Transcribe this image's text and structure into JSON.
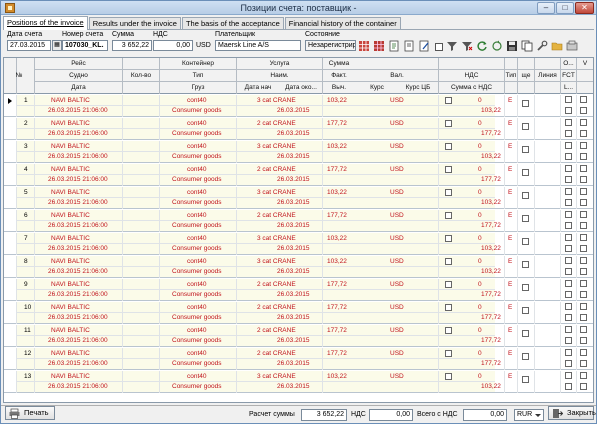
{
  "window": {
    "title": "Позиции счета: поставщик -",
    "min_label": "–",
    "max_label": "□",
    "close_label": "✕"
  },
  "tabs": [
    "Positions of the invoice",
    "Results under the invoice",
    "The basis of the acceptance",
    "Financial history of the container"
  ],
  "header": {
    "date_label": "Дата счета",
    "date_value": "27.03.2015",
    "number_label": "Номер счета",
    "number_value": "107030_KL.",
    "sum_label": "Сумма",
    "sum_value": "3 652,22",
    "vat_label": "НДС",
    "vat_value": "0,00",
    "currency": "USD",
    "payer_label": "Плательщик",
    "payer_value": "Maersk Line A/S",
    "state_label": "Состояние",
    "state_value": "Незарегистрир"
  },
  "columns": {
    "num": "№",
    "flight": "Рейс",
    "vessel": "Судно",
    "date": "Дата",
    "qty": "Кол-во",
    "container": "Контейнер",
    "type": "Тип",
    "cargo": "Груз",
    "service": "Услуга",
    "name": "Наим.",
    "start_date": "Дата нач",
    "end_date": "Дата око...",
    "sum": "Сумма",
    "fact": "Факт.",
    "calc": "Выч.",
    "currency": "Вал.",
    "rate": "Курс",
    "rate_cb": "Курс ЦБ",
    "vat": "НДС",
    "sum_vat": "Сумма с НДС",
    "tip": "Тип",
    "sche": "ще",
    "line": "Линия",
    "o": "О...",
    "fct": "FCT",
    "l": "L...",
    "v": "V"
  },
  "rows": [
    {
      "num": "1",
      "vessel": "NAVI BALTIC",
      "date": "26.03.2015 21:06:00",
      "type": "cont40",
      "cargo": "Consumer goods",
      "service": "3 cat CRANE",
      "svc_date": "26.03.2015",
      "fact": "103,22",
      "calc": "",
      "currency": "USD",
      "vat": "0",
      "sum_vat": "103,22",
      "tip": "E"
    },
    {
      "num": "2",
      "vessel": "NAVI BALTIC",
      "date": "26.03.2015 21:06:00",
      "type": "cont40",
      "cargo": "Consumer goods",
      "service": "2 cat CRANE",
      "svc_date": "26.03.2015",
      "fact": "177,72",
      "calc": "",
      "currency": "USD",
      "vat": "0",
      "sum_vat": "177,72",
      "tip": "E"
    },
    {
      "num": "3",
      "vessel": "NAVI BALTIC",
      "date": "26.03.2015 21:06:00",
      "type": "cont40",
      "cargo": "Consumer goods",
      "service": "3 cat CRANE",
      "svc_date": "26.03.2015",
      "fact": "103,22",
      "calc": "",
      "currency": "USD",
      "vat": "0",
      "sum_vat": "103,22",
      "tip": "E"
    },
    {
      "num": "4",
      "vessel": "NAVI BALTIC",
      "date": "26.03.2015 21:06:00",
      "type": "cont40",
      "cargo": "Consumer goods",
      "service": "2 cat CRANE",
      "svc_date": "26.03.2015",
      "fact": "177,72",
      "calc": "",
      "currency": "USD",
      "vat": "0",
      "sum_vat": "177,72",
      "tip": "E"
    },
    {
      "num": "5",
      "vessel": "NAVI BALTIC",
      "date": "26.03.2015 21:06:00",
      "type": "cont40",
      "cargo": "Consumer goods",
      "service": "3 cat CRANE",
      "svc_date": "26.03.2015",
      "fact": "103,22",
      "calc": "",
      "currency": "USD",
      "vat": "0",
      "sum_vat": "103,22",
      "tip": "E"
    },
    {
      "num": "6",
      "vessel": "NAVI BALTIC",
      "date": "26.03.2015 21:06:00",
      "type": "cont40",
      "cargo": "Consumer goods",
      "service": "2 cat CRANE",
      "svc_date": "26.03.2015",
      "fact": "177,72",
      "calc": "",
      "currency": "USD",
      "vat": "0",
      "sum_vat": "177,72",
      "tip": "E"
    },
    {
      "num": "7",
      "vessel": "NAVI BALTIC",
      "date": "26.03.2015 21:06:00",
      "type": "cont40",
      "cargo": "Consumer goods",
      "service": "3 cat CRANE",
      "svc_date": "26.03.2015",
      "fact": "103,22",
      "calc": "",
      "currency": "USD",
      "vat": "0",
      "sum_vat": "103,22",
      "tip": "E"
    },
    {
      "num": "8",
      "vessel": "NAVI BALTIC",
      "date": "26.03.2015 21:06:00",
      "type": "cont40",
      "cargo": "Consumer goods",
      "service": "3 cat CRANE",
      "svc_date": "26.03.2015",
      "fact": "103,22",
      "calc": "",
      "currency": "USD",
      "vat": "0",
      "sum_vat": "103,22",
      "tip": "E"
    },
    {
      "num": "9",
      "vessel": "NAVI BALTIC",
      "date": "26.03.2015 21:06:00",
      "type": "cont40",
      "cargo": "Consumer goods",
      "service": "2 cat CRANE",
      "svc_date": "26.03.2015",
      "fact": "177,72",
      "calc": "",
      "currency": "USD",
      "vat": "0",
      "sum_vat": "177,72",
      "tip": "E"
    },
    {
      "num": "10",
      "vessel": "NAVI BALTIC",
      "date": "26.03.2015 21:06:00",
      "type": "cont40",
      "cargo": "Consumer goods",
      "service": "2 cat CRANE",
      "svc_date": "26.03.2015",
      "fact": "177,72",
      "calc": "",
      "currency": "USD",
      "vat": "0",
      "sum_vat": "177,72",
      "tip": "E"
    },
    {
      "num": "11",
      "vessel": "NAVI BALTIC",
      "date": "26.03.2015 21:06:00",
      "type": "cont40",
      "cargo": "Consumer goods",
      "service": "2 cat CRANE",
      "svc_date": "26.03.2015",
      "fact": "177,72",
      "calc": "",
      "currency": "USD",
      "vat": "0",
      "sum_vat": "177,72",
      "tip": "E"
    },
    {
      "num": "12",
      "vessel": "NAVI BALTIC",
      "date": "26.03.2015 21:06:00",
      "type": "cont40",
      "cargo": "Consumer goods",
      "service": "2 cat CRANE",
      "svc_date": "26.03.2015",
      "fact": "177,72",
      "calc": "",
      "currency": "USD",
      "vat": "0",
      "sum_vat": "177,72",
      "tip": "E"
    },
    {
      "num": "13",
      "vessel": "NAVI BALTIC",
      "date": "26.03.2015 21:06:00",
      "type": "cont40",
      "cargo": "Consumer goods",
      "service": "3 cat CRANE",
      "svc_date": "26.03.2015",
      "fact": "103,22",
      "calc": "",
      "currency": "USD",
      "vat": "0",
      "sum_vat": "103,22",
      "tip": "E"
    }
  ],
  "footer": {
    "print_label": "Печать",
    "total_label": "Расчет суммы",
    "total_value": "3 652,22",
    "vat_label": "НДС",
    "vat_value": "0,00",
    "total_vat_label": "Всего с НДС",
    "total_vat_value": "0,00",
    "currency_value": "RUR",
    "close_label": "Закрыть"
  },
  "toolbar_icons": [
    "grid-icon",
    "grid-alt-icon",
    "export-icon",
    "document-icon",
    "document-edit-icon",
    "checkbox-toggle",
    "filter-icon",
    "filter-clear-icon",
    "refresh-icon",
    "recycle-icon",
    "save-icon",
    "copy-icon",
    "tools-icon",
    "folder-icon",
    "settings-icon"
  ],
  "colors": {
    "accent_red": "#c0121a",
    "row_band": "#fbfbe9",
    "title_bar": "#b7cde6"
  }
}
